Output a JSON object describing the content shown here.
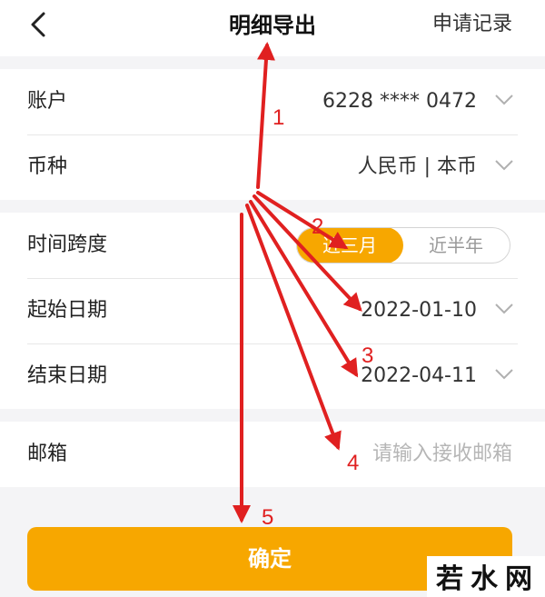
{
  "header": {
    "title": "明细导出",
    "right_link": "申请记录"
  },
  "account": {
    "label": "账户",
    "value": "6228 **** 0472"
  },
  "currency": {
    "label": "币种",
    "value": "人民币 | 本币"
  },
  "time_span": {
    "label": "时间跨度",
    "options": [
      "近三月",
      "近半年"
    ],
    "selected": "近三月"
  },
  "start_date": {
    "label": "起始日期",
    "value": "2022-01-10"
  },
  "end_date": {
    "label": "结束日期",
    "value": "2022-04-11"
  },
  "email": {
    "label": "邮箱",
    "placeholder": "请输入接收邮箱"
  },
  "confirm_label": "确定",
  "annotations": {
    "numbers": [
      "1",
      "2",
      "3",
      "4",
      "5"
    ],
    "color": "#e02020"
  },
  "colors": {
    "accent": "#f7a700",
    "background": "#f4f4f6"
  },
  "watermark": "若水网"
}
